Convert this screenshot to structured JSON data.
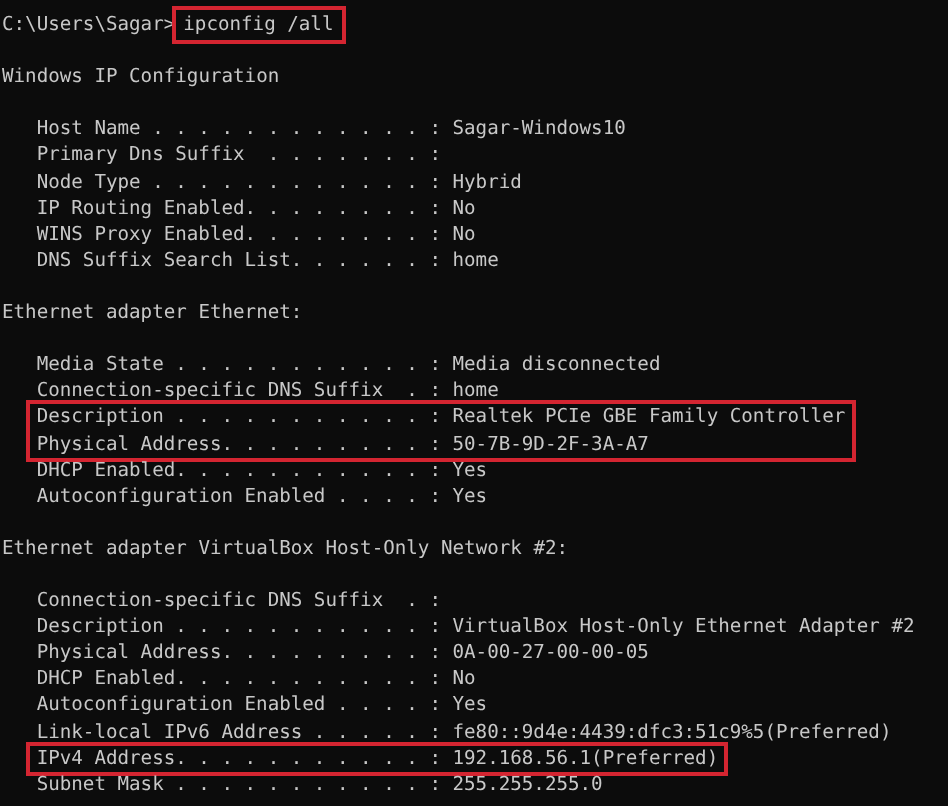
{
  "prompt": {
    "path": "C:\\Users\\Sagar>",
    "command": "ipconfig /all",
    "highlighted": true
  },
  "sections": [
    {
      "title": "Windows IP Configuration",
      "entries": [
        {
          "label": "Host Name . . . . . . . . . . . . :",
          "value": "Sagar-Windows10",
          "highlighted": false
        },
        {
          "label": "Primary Dns Suffix  . . . . . . . :",
          "highlighted": false
        },
        {
          "label": "Node Type . . . . . . . . . . . . :",
          "value": "Hybrid",
          "highlighted": false
        },
        {
          "label": "IP Routing Enabled. . . . . . . . :",
          "value": "No",
          "highlighted": false
        },
        {
          "label": "WINS Proxy Enabled. . . . . . . . :",
          "value": "No",
          "highlighted": false
        },
        {
          "label": "DNS Suffix Search List. . . . . . :",
          "value": "home",
          "highlighted": false
        }
      ]
    },
    {
      "title": "Ethernet adapter Ethernet:",
      "entries": [
        {
          "label": "Media State . . . . . . . . . . . :",
          "value": "Media disconnected",
          "highlighted": false
        },
        {
          "label": "Connection-specific DNS Suffix  . :",
          "value": "home",
          "highlighted": false
        },
        {
          "label": "Description . . . . . . . . . . . :",
          "value": "Realtek PCIe GBE Family Controller",
          "highlighted": true
        },
        {
          "label": "Physical Address. . . . . . . . . :",
          "value": "50-7B-9D-2F-3A-A7",
          "highlighted": true
        },
        {
          "label": "DHCP Enabled. . . . . . . . . . . :",
          "value": "Yes",
          "highlighted": false
        },
        {
          "label": "Autoconfiguration Enabled . . . . :",
          "value": "Yes",
          "highlighted": false
        }
      ]
    },
    {
      "title": "Ethernet adapter VirtualBox Host-Only Network #2:",
      "entries": [
        {
          "label": "Connection-specific DNS Suffix  . :",
          "highlighted": false
        },
        {
          "label": "Description . . . . . . . . . . . :",
          "value": "VirtualBox Host-Only Ethernet Adapter #2",
          "highlighted": false
        },
        {
          "label": "Physical Address. . . . . . . . . :",
          "value": "0A-00-27-00-00-05",
          "highlighted": false
        },
        {
          "label": "DHCP Enabled. . . . . . . . . . . :",
          "value": "No",
          "highlighted": false
        },
        {
          "label": "Autoconfiguration Enabled . . . . :",
          "value": "Yes",
          "highlighted": false
        },
        {
          "label": "Link-local IPv6 Address . . . . . :",
          "value": "fe80::9d4e:4439:dfc3:51c9%5(Preferred)",
          "highlighted": false
        },
        {
          "label": "IPv4 Address. . . . . . . . . . . :",
          "value": "192.168.56.1(Preferred)",
          "highlighted": true
        },
        {
          "label": "Subnet Mask . . . . . . . . . . . :",
          "value": "255.255.255.0",
          "highlighted": false
        }
      ]
    }
  ]
}
